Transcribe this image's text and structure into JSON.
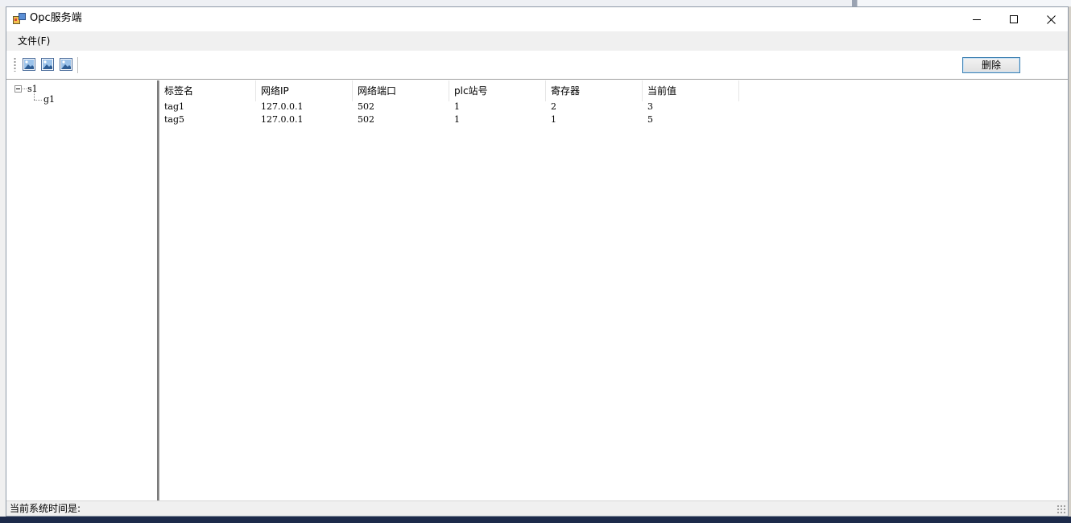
{
  "window": {
    "title": "Opc服务端"
  },
  "menu": {
    "items": [
      {
        "label": "文件(F)"
      }
    ]
  },
  "toolbar": {
    "buttons": [
      {
        "icon": "image-icon"
      },
      {
        "icon": "image-icon"
      },
      {
        "icon": "image-icon"
      }
    ],
    "delete_label": "删除"
  },
  "tree": {
    "nodes": [
      {
        "label": "s1",
        "expanded": true,
        "children": [
          {
            "label": "g1"
          }
        ]
      }
    ]
  },
  "table": {
    "columns": [
      "标签名",
      "网络IP",
      "网络端口",
      "plc站号",
      "寄存器",
      "当前值"
    ],
    "rows": [
      [
        "tag1",
        "127.0.0.1",
        "502",
        "1",
        "2",
        "3"
      ],
      [
        "tag5",
        "127.0.0.1",
        "502",
        "1",
        "1",
        "5"
      ]
    ]
  },
  "status": {
    "text": "当前系统时间是:"
  },
  "colors": {
    "accent": "#3c7fb1",
    "menubar": "#f0f0f0",
    "window_bg": "#ffffff"
  }
}
